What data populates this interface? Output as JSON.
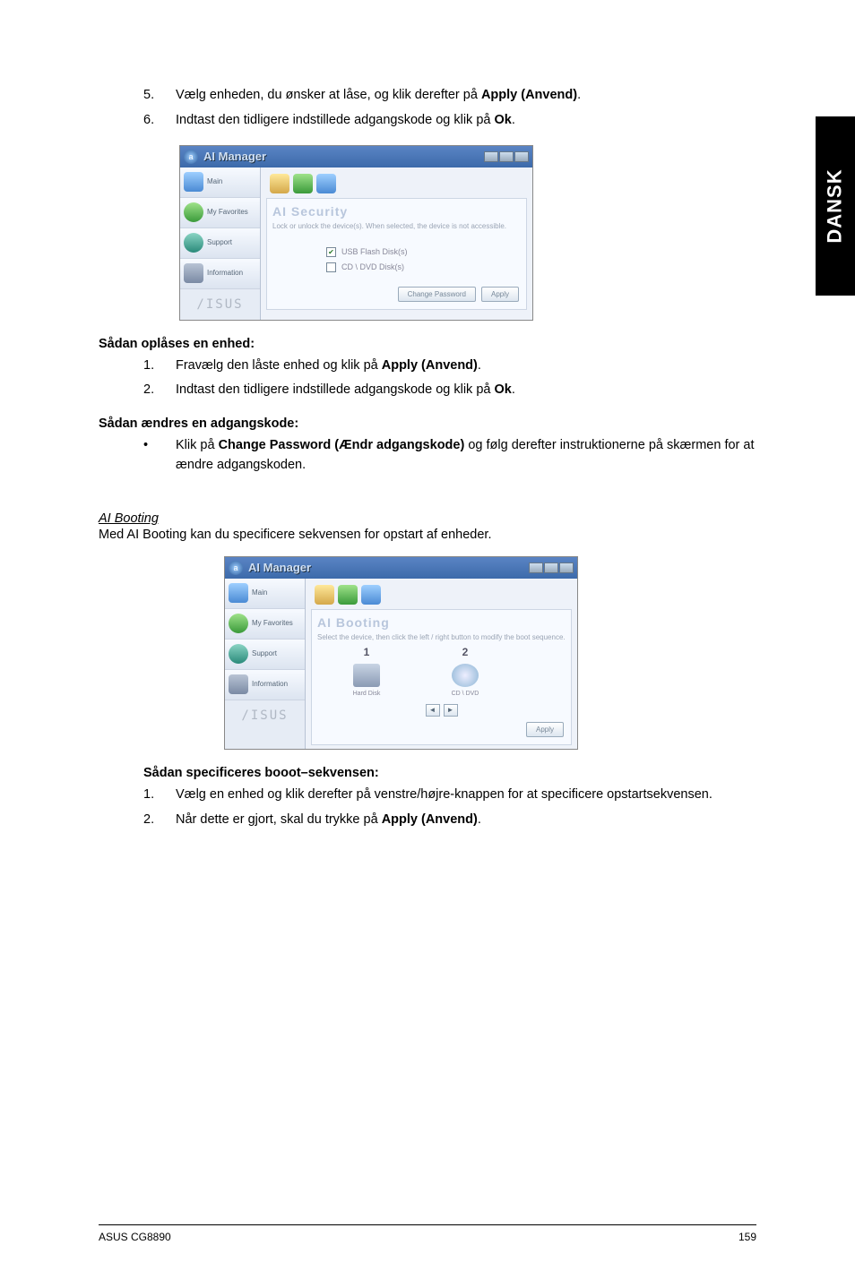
{
  "sideTab": "DANSK",
  "topList": {
    "items": [
      {
        "num": "5.",
        "pre": "Vælg enheden, du ønsker at låse, og klik derefter på ",
        "bold": "Apply (Anvend)",
        "post": "."
      },
      {
        "num": "6.",
        "pre": "Indtast den tidligere indstillede adgangskode og klik på ",
        "bold": "Ok",
        "post": "."
      }
    ]
  },
  "screenshot1": {
    "title": "AI Manager",
    "sidebar": [
      "Main",
      "My Favorites",
      "Support",
      "Information"
    ],
    "brand": "/ISUS",
    "panelTitle": "AI Security",
    "panelDesc": "Lock or unlock the device(s). When selected, the device is not accessible.",
    "opt1": "USB Flash Disk(s)",
    "opt2": "CD \\ DVD Disk(s)",
    "btnChange": "Change Password",
    "btnApply": "Apply"
  },
  "unlockHeading": "Sådan oplåses en enhed:",
  "unlockList": {
    "items": [
      {
        "num": "1.",
        "pre": "Fravælg den låste enhed og klik på ",
        "bold": "Apply (Anvend)",
        "post": "."
      },
      {
        "num": "2.",
        "pre": "Indtast den tidligere indstillede adgangskode og klik på ",
        "bold": "Ok",
        "post": "."
      }
    ]
  },
  "changeHeading": "Sådan ændres en adgangskode:",
  "changeBullet": {
    "num": "•",
    "pre": "Klik på ",
    "bold": "Change Password (Ændr adgangskode)",
    "post": " og følg derefter instruktionerne på skærmen for at ændre adgangskoden."
  },
  "bootingTitle": "AI Booting",
  "bootingDesc": "Med AI Booting kan du specificere sekvensen for opstart af enheder.",
  "screenshot2": {
    "title": "AI Manager",
    "sidebar": [
      "Main",
      "My Favorites",
      "Support",
      "Information"
    ],
    "brand": "/ISUS",
    "panelTitle": "AI Booting",
    "panelDesc": "Select the device, then click the left / right button to modify the boot sequence.",
    "col1num": "1",
    "col1label": "Hard Disk",
    "col2num": "2",
    "col2label": "CD \\ DVD",
    "btnApply": "Apply"
  },
  "specHeading": "Sådan specificeres booot–sekvensen:",
  "specList": {
    "items": [
      {
        "num": "1.",
        "pre": "Vælg en enhed og klik derefter på venstre/højre-knappen for at specificere opstartsekvensen.",
        "bold": "",
        "post": ""
      },
      {
        "num": "2.",
        "pre": "Når dette er gjort, skal du trykke på ",
        "bold": "Apply (Anvend)",
        "post": "."
      }
    ]
  },
  "footerLeft": "ASUS CG8890",
  "footerRight": "159"
}
